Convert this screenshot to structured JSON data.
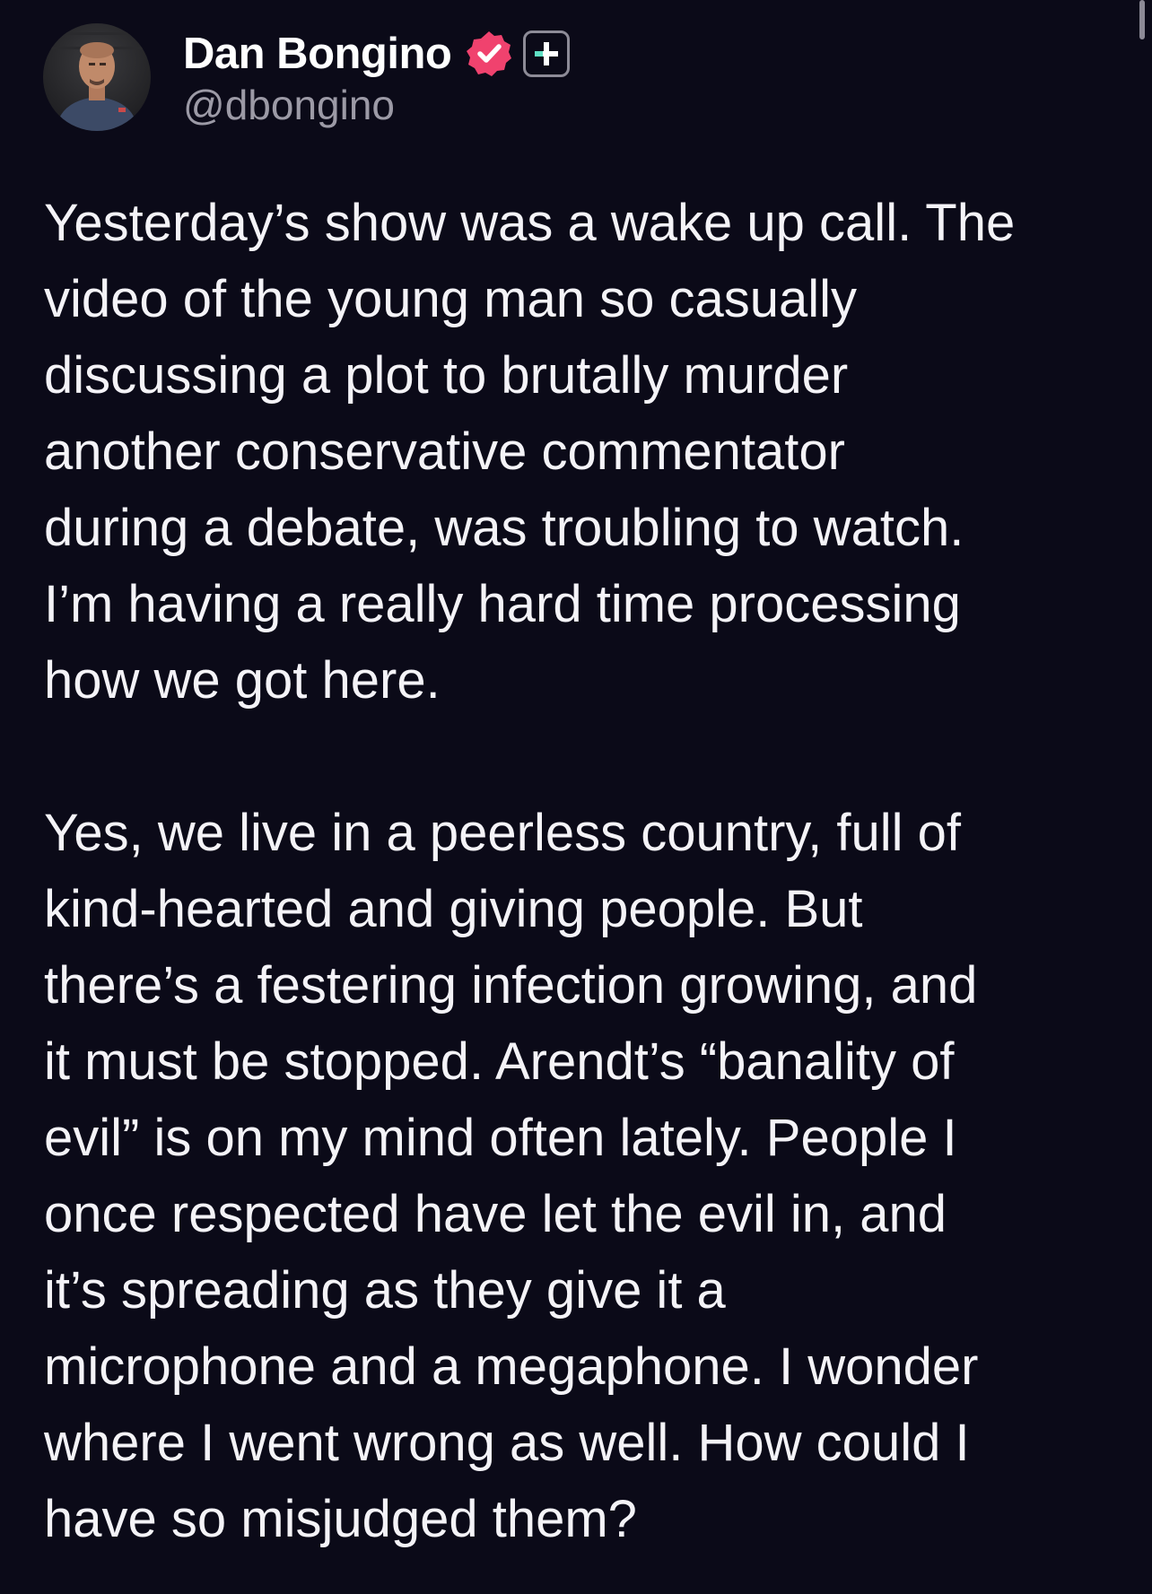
{
  "author": {
    "display_name": "Dan Bongino",
    "handle": "@dbongino",
    "avatar_icon": "profile-photo",
    "verified_icon": "verified-badge-icon",
    "verified_color": "#f0426e",
    "plus_icon": "plus-subscription-icon",
    "plus_color": "#5fe0c4"
  },
  "post": {
    "paragraphs": [
      {
        "lines": [
          "Yesterday’s show was a wake up call. The",
          "video of the young man so casually",
          "discussing a plot to brutally murder",
          "another conservative commentator",
          "during a debate, was troubling to watch.",
          "I’m having a really hard time processing",
          "how we got here."
        ]
      },
      {
        "lines": [
          "Yes, we live in a peerless country, full of",
          "kind-hearted and giving people. But",
          "there’s a festering infection growing, and",
          "it must be stopped. Arendt’s “banality of",
          "evil” is on my mind often lately. People I",
          "once respected have let the evil in, and",
          "it’s spreading as they give it a",
          "microphone and a megaphone. I wonder",
          "where I went wrong as well. How could I",
          "have so misjudged them?"
        ]
      }
    ]
  },
  "colors": {
    "background": "#0b0a18",
    "text": "#f4f3f7",
    "handle": "#9c9aa6"
  }
}
